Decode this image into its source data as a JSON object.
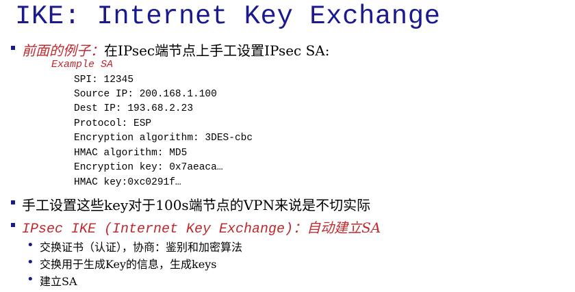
{
  "title": "IKE: Internet Key Exchange",
  "bullet1": {
    "prefix": "前面的例子：",
    "text": "在IPsec端节点上手工设置IPsec SA:"
  },
  "example": {
    "title": "Example SA",
    "items": [
      "SPI: 12345",
      "Source IP: 200.168.1.100",
      "Dest IP: 193.68.2.23",
      "Protocol: ESP",
      "Encryption algorithm: 3DES-cbc",
      "HMAC algorithm: MD5",
      "Encryption key: 0x7aeaca…",
      "HMAC key:0xc0291f…"
    ]
  },
  "bullet2": {
    "text": "手工设置这些key对于100s端节点的VPN来说是不切实际"
  },
  "bullet3": {
    "prefix": "IPsec IKE (Internet Key Exchange)：",
    "text": "自动建立SA"
  },
  "subitems": [
    "交换证书（认证），协商：鉴别和加密算法",
    "交换用于生成Key的信息，生成keys",
    "建立SA"
  ],
  "colors": {
    "title": "#1a1a8c",
    "accent": "#c0282d",
    "bullet": "#1a1a8c"
  }
}
